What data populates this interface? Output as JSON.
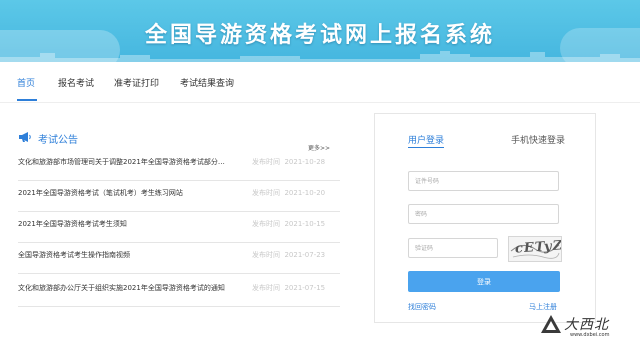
{
  "header": {
    "title": "全国导游资格考试网上报名系统"
  },
  "nav": {
    "items": [
      {
        "label": "首页",
        "active": true
      },
      {
        "label": "报名考试",
        "active": false
      },
      {
        "label": "准考证打印",
        "active": false
      },
      {
        "label": "考试结果查询",
        "active": false
      }
    ]
  },
  "notices": {
    "title": "考试公告",
    "icon": "megaphone-icon",
    "more_label": "更多>>",
    "date_prefix": "发布时间",
    "items": [
      {
        "title": "文化和旅游部市场管理司关于调整2021年全国导游资格考试部分…",
        "date": "2021-10-28"
      },
      {
        "title": "2021年全国导游资格考试（笔试机考）考生练习网站",
        "date": "2021-10-20"
      },
      {
        "title": "2021年全国导游资格考试考生须知",
        "date": "2021-10-15"
      },
      {
        "title": "全国导游资格考试考生操作指南视频",
        "date": "2021-07-23"
      },
      {
        "title": "文化和旅游部办公厅关于组织实施2021年全国导游资格考试的通知",
        "date": "2021-07-15"
      }
    ]
  },
  "login": {
    "tab_user": "用户登录",
    "tab_mobile": "手机快速登录",
    "id_placeholder": "证件号码",
    "password_placeholder": "密码",
    "captcha_placeholder": "验证码",
    "captcha_text": "cETyZ",
    "button": "登录",
    "forgot_password": "找回密码",
    "register": "马上注册"
  },
  "watermark": {
    "text": "大西北",
    "url": "www.dxbei.com"
  },
  "colors": {
    "accent": "#2e7fd9",
    "banner": "#4dbde6",
    "button": "#4aa3ee"
  }
}
